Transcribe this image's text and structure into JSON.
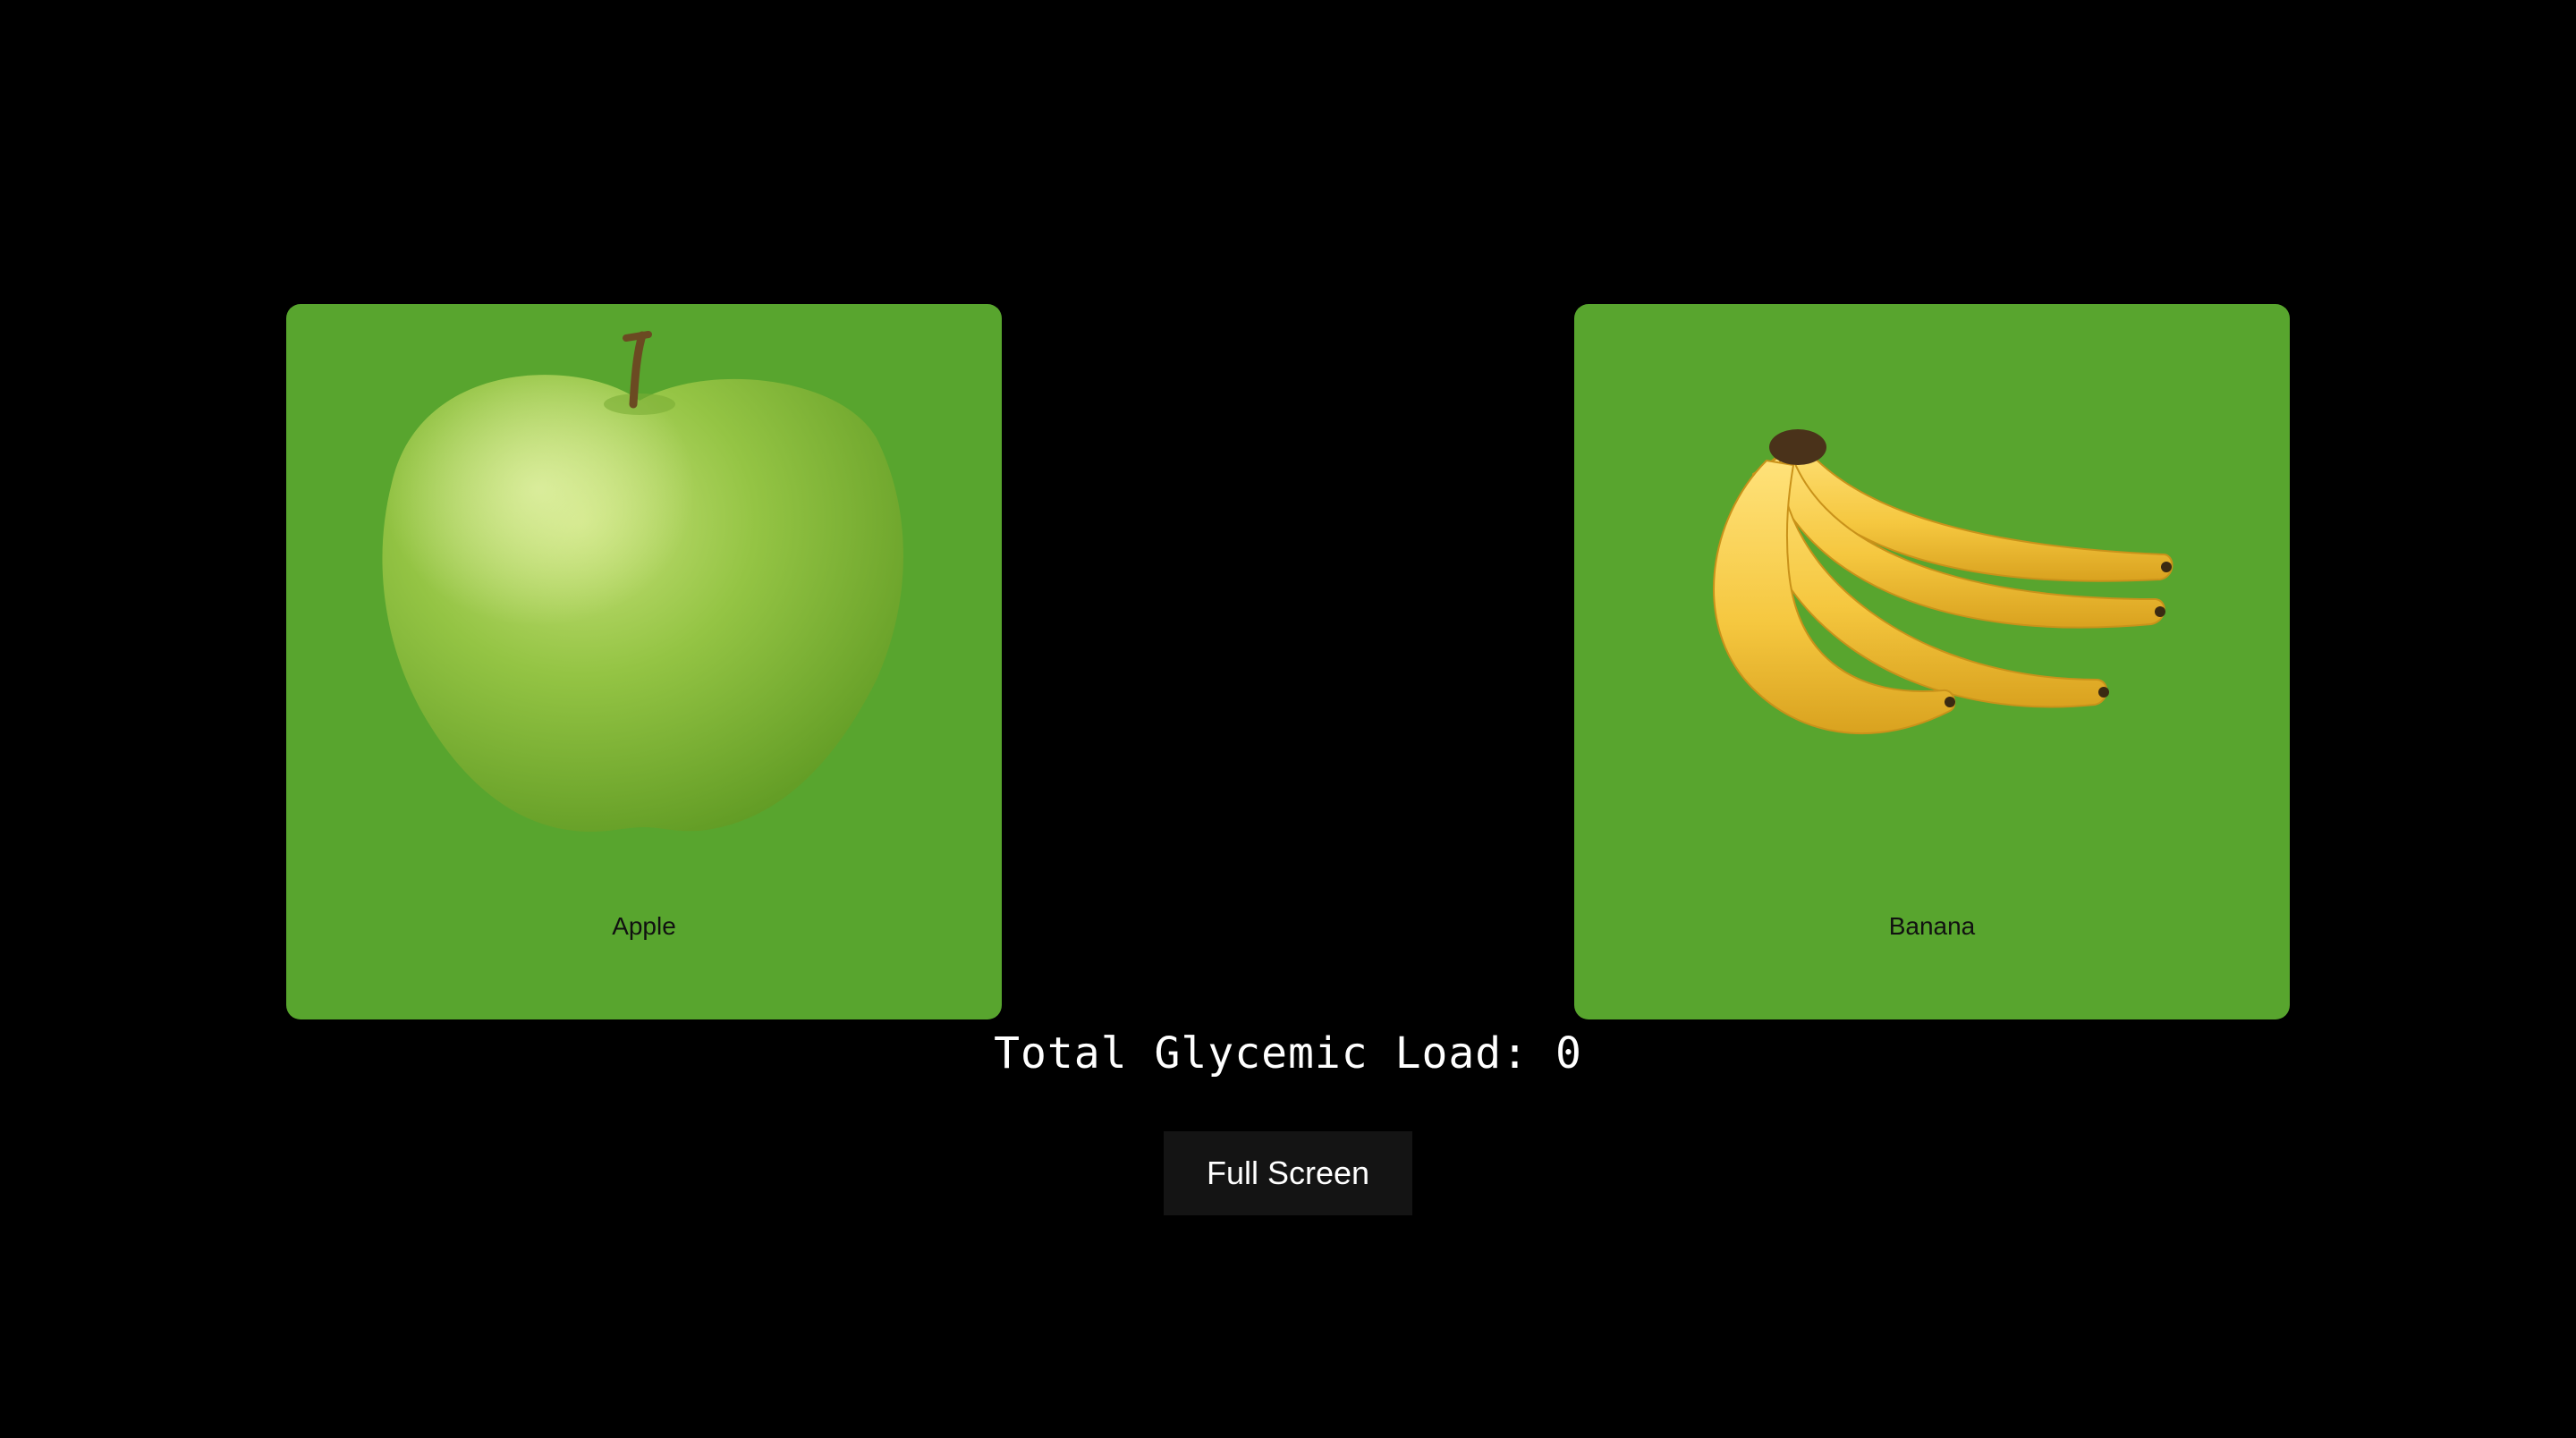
{
  "cards": [
    {
      "label": "Apple",
      "icon": "apple-image"
    },
    {
      "label": "Banana",
      "icon": "banana-image"
    }
  ],
  "total": {
    "text": "Total Glycemic Load: 0"
  },
  "fullscreen_button": {
    "label": "Full Screen"
  },
  "colors": {
    "background": "#000000",
    "card": "#58a52e",
    "button": "#141414",
    "apple": "#8fc23f",
    "banana": "#f2c53d"
  }
}
